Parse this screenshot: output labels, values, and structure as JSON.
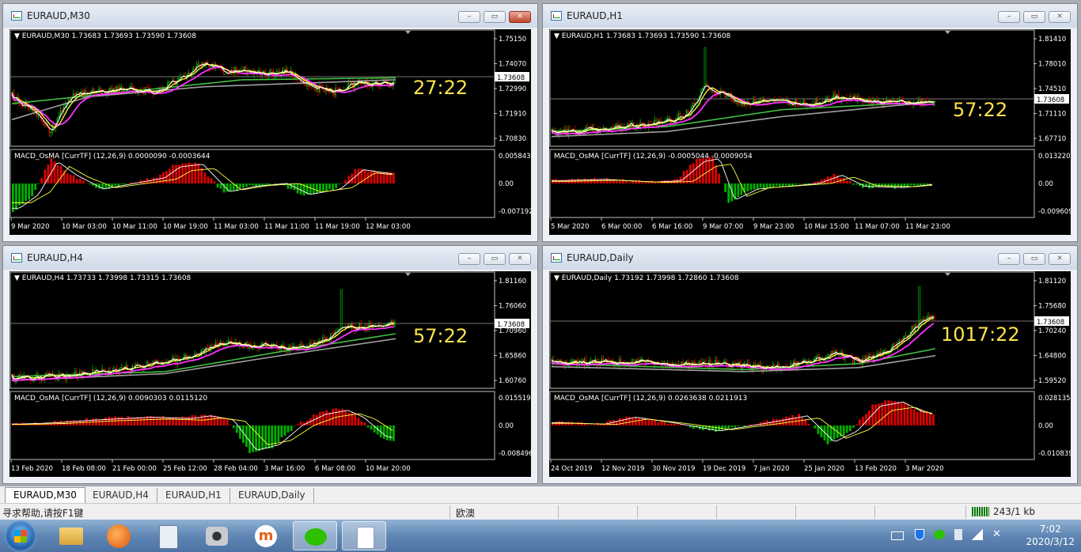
{
  "windows": [
    {
      "title": "EURAUD,M30",
      "info": "EURAUD,M30  1.73683 1.73693 1.73590 1.73608",
      "timer": "27:22",
      "macd": "MACD_OsMA [CurrTF] (12,26,9) 0.0000090 -0.0003644",
      "price_labels": [
        "1.75150",
        "1.74070",
        "1.72990",
        "1.71910",
        "1.70830"
      ],
      "current_price": "1.73608",
      "macd_labels": [
        "0.0058438",
        "0.00",
        "-0.007192"
      ],
      "time_labels": [
        "9 Mar 2020",
        "10 Mar 03:00",
        "10 Mar 11:00",
        "10 Mar 19:00",
        "11 Mar 03:00",
        "11 Mar 11:00",
        "11 Mar 19:00",
        "12 Mar 03:00"
      ],
      "active": true
    },
    {
      "title": "EURAUD,H1",
      "info": "EURAUD,H1  1.73683 1.73693 1.73590 1.73608",
      "timer": "57:22",
      "macd": "MACD_OsMA [CurrTF] (12,26,9) -0.0005044 -0.0009054",
      "price_labels": [
        "1.81410",
        "1.78010",
        "1.74510",
        "1.71110",
        "1.67710"
      ],
      "current_price": "1.73608",
      "macd_labels": [
        "0.0132201",
        "0.00",
        "-0.009609"
      ],
      "time_labels": [
        "5 Mar 2020",
        "6 Mar 00:00",
        "6 Mar 16:00",
        "9 Mar 07:00",
        "9 Mar 23:00",
        "10 Mar 15:00",
        "11 Mar 07:00",
        "11 Mar 23:00"
      ],
      "active": false
    },
    {
      "title": "EURAUD,H4",
      "info": "EURAUD,H4  1.73733 1.73998 1.73315 1.73608",
      "timer": "57:22",
      "macd": "MACD_OsMA [CurrTF] (12,26,9) 0.0090303 0.0115120",
      "price_labels": [
        "1.81160",
        "1.76060",
        "1.70960",
        "1.65860",
        "1.60760"
      ],
      "current_price": "1.73608",
      "macd_labels": [
        "0.0155195",
        "0.00",
        "-0.008496"
      ],
      "time_labels": [
        "13 Feb 2020",
        "18 Feb 08:00",
        "21 Feb 00:00",
        "25 Feb 12:00",
        "28 Feb 04:00",
        "3 Mar 16:00",
        "6 Mar 08:00",
        "10 Mar 20:00"
      ],
      "active": false
    },
    {
      "title": "EURAUD,Daily",
      "info": "EURAUD,Daily  1.73192 1.73998 1.72860 1.73608",
      "timer": "1017:22",
      "macd": "MACD_OsMA [CurrTF] (12,26,9) 0.0263638 0.0211913",
      "price_labels": [
        "1.81120",
        "1.75680",
        "1.70240",
        "1.64800",
        "1.59520"
      ],
      "current_price": "1.73608",
      "macd_labels": [
        "0.0281354",
        "0.00",
        "-0.010839"
      ],
      "time_labels": [
        "24 Oct 2019",
        "12 Nov 2019",
        "30 Nov 2019",
        "19 Dec 2019",
        "7 Jan 2020",
        "25 Jan 2020",
        "13 Feb 2020",
        "3 Mar 2020"
      ],
      "active": false
    }
  ],
  "tabs": [
    "EURAUD,M30",
    "EURAUD,H4",
    "EURAUD,H1",
    "EURAUD,Daily"
  ],
  "status": {
    "help": "寻求帮助,请按F1键",
    "profile": "欧澳",
    "traffic": "243/1 kb"
  },
  "clock": {
    "time": "7:02",
    "date": "2020/3/12"
  },
  "colors": {
    "bull": "#00b000",
    "bear": "#e00000",
    "ma_fast": "#ffffff",
    "ma_yellow": "#ffff40",
    "ma_magenta": "#ff30ff",
    "ma_green": "#40c040",
    "ma_gray": "#a0a0a0",
    "timer": "#ffe44a"
  }
}
